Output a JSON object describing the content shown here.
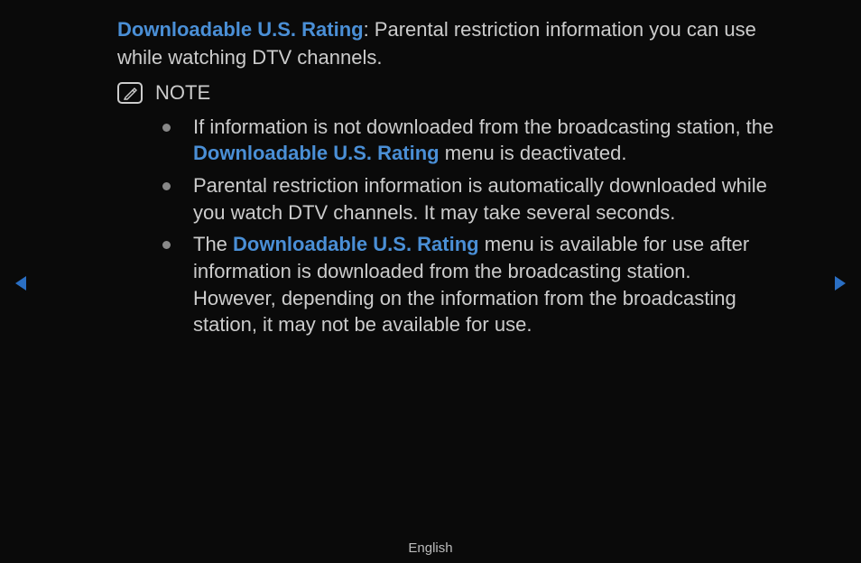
{
  "intro": {
    "highlight": "Downloadable U.S. Rating",
    "rest": ": Parental restriction information you can use while watching DTV channels."
  },
  "note": {
    "label": "NOTE"
  },
  "bullets": [
    {
      "pre": "If information is not downloaded from the broadcasting station, the ",
      "highlight": "Downloadable U.S. Rating",
      "post": " menu is deactivated."
    },
    {
      "pre": "Parental restriction information is automatically downloaded while you watch DTV channels. It may take several seconds.",
      "highlight": "",
      "post": ""
    },
    {
      "pre": "The ",
      "highlight": "Downloadable U.S. Rating",
      "post": " menu is available for use after information is downloaded from the broadcasting station. However, depending on the information from the broadcasting station, it may not be available for use."
    }
  ],
  "footer": {
    "language": "English"
  }
}
